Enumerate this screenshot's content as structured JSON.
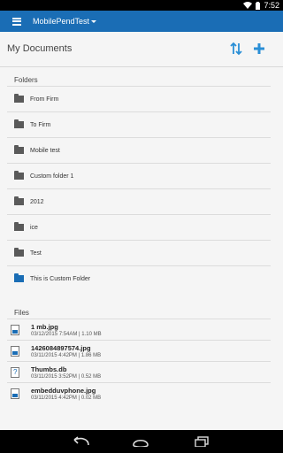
{
  "status_bar": {
    "time": "7:52",
    "icons": [
      "wifi-icon",
      "battery-icon"
    ]
  },
  "app_bar": {
    "title": "MobilePendTest",
    "accent": "#1a6db5"
  },
  "header": {
    "title": "My Documents",
    "icons": [
      "sort-icon",
      "add-icon"
    ]
  },
  "folders": {
    "label": "Folders",
    "items": [
      {
        "label": "From Firm",
        "color": "#5a5a5a"
      },
      {
        "label": "To Firm",
        "color": "#5a5a5a"
      },
      {
        "label": "Mobile test",
        "color": "#5a5a5a"
      },
      {
        "label": "Custom folder 1",
        "color": "#5a5a5a"
      },
      {
        "label": "2012",
        "color": "#5a5a5a"
      },
      {
        "label": "ice",
        "color": "#5a5a5a"
      },
      {
        "label": "Test",
        "color": "#5a5a5a"
      },
      {
        "label": "This is Custom Folder",
        "color": "#1a6db5"
      }
    ]
  },
  "files": {
    "label": "Files",
    "items": [
      {
        "name": "1 mb.jpg",
        "meta": "03/12/2015 7:54AM | 1.10 MB",
        "icon": "image-file-icon"
      },
      {
        "name": "1426084897574.jpg",
        "meta": "03/11/2015 4:42PM | 1.86 MB",
        "icon": "image-file-icon"
      },
      {
        "name": "Thumbs.db",
        "meta": "03/11/2015 3:52PM | 0.52 MB",
        "icon": "unknown-file-icon"
      },
      {
        "name": "embedduvphone.jpg",
        "meta": "03/11/2015 4:42PM | 0.02 MB",
        "icon": "image-file-icon"
      }
    ]
  },
  "nav_bar": {
    "icons": [
      "back-icon",
      "home-icon",
      "recents-icon"
    ]
  }
}
